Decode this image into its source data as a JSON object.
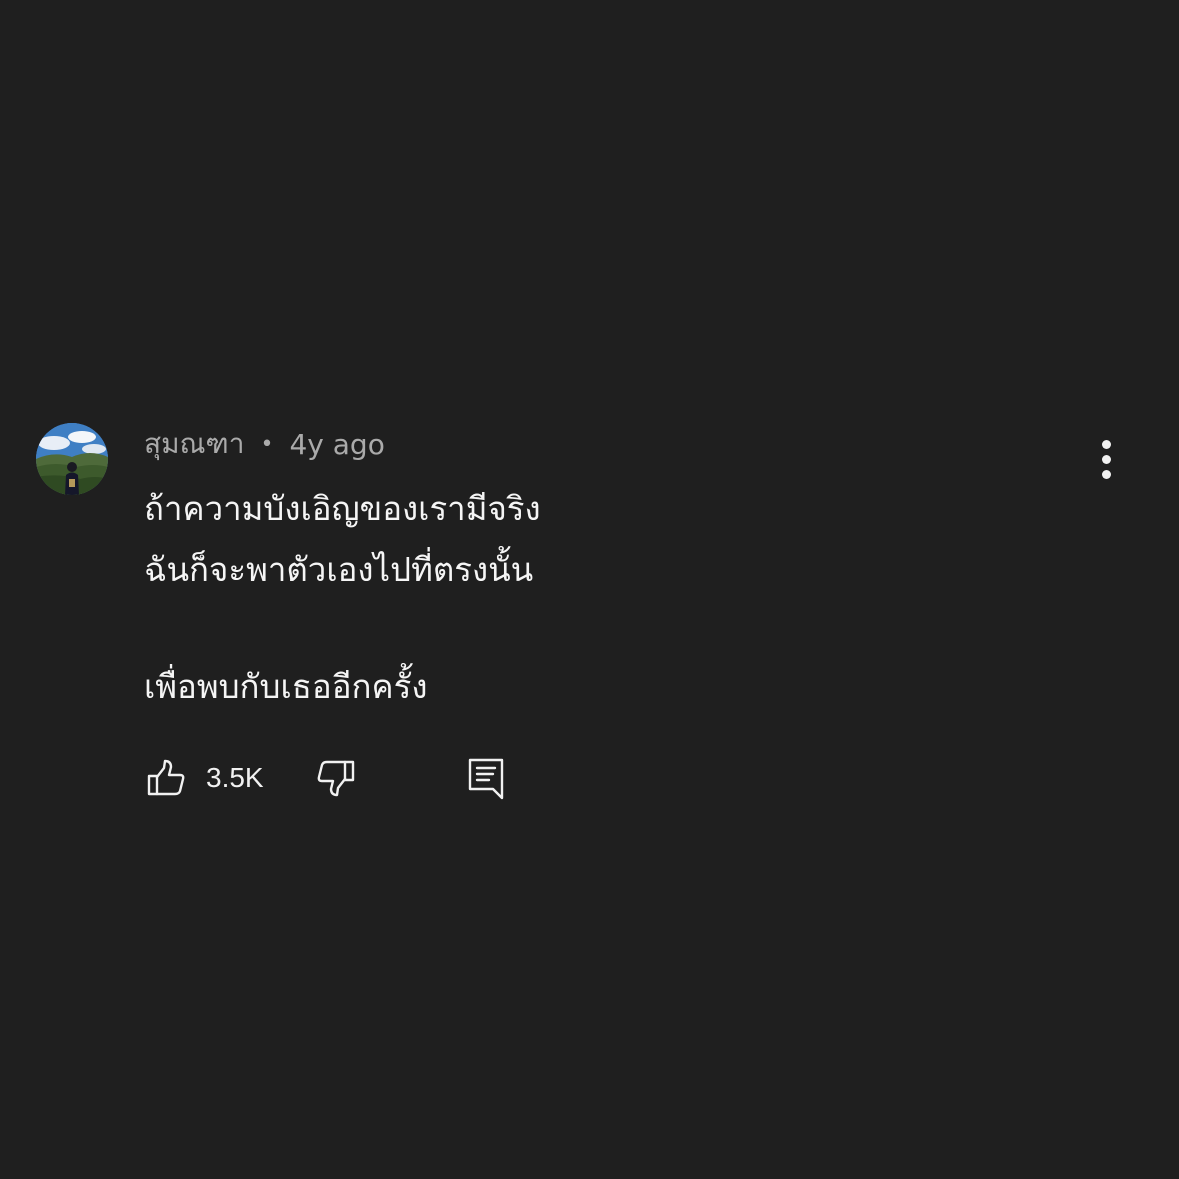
{
  "comment": {
    "author": "สุมณฑา",
    "separator": "•",
    "time": "4y ago",
    "lines": [
      "ถ้าความบังเอิญของเรามีจริง",
      "ฉันก็จะพาตัวเองไปที่ตรงนั้น",
      "เพื่อพบกับเธออีกครั้ง"
    ],
    "like_count": "3.5K"
  },
  "icons": {
    "avatar": "profile-photo",
    "more": "more-vertical-icon",
    "like": "thumb-up-icon",
    "dislike": "thumb-down-icon",
    "reply": "comment-reply-icon"
  },
  "colors": {
    "background": "#1f1f1f",
    "text": "#f1f1f1",
    "secondary_text": "#aaaaaa"
  }
}
